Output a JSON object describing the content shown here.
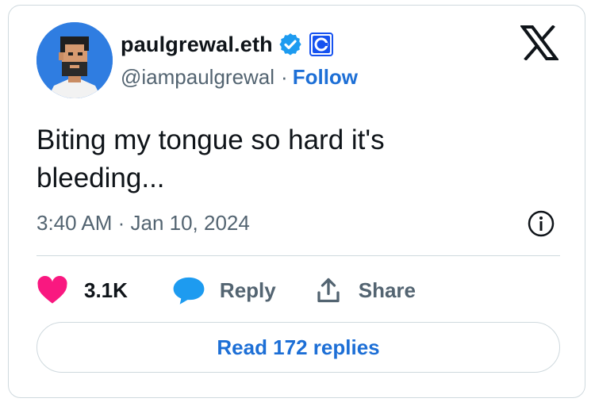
{
  "author": {
    "display_name": "paulgrewal.eth",
    "handle": "@iampaulgrewal",
    "separator": "·",
    "follow_label": "Follow",
    "verified_color": "#1d9bf0",
    "affiliate_color": "#1652f0"
  },
  "tweet": {
    "text": "Biting my tongue so hard it's bleeding...",
    "time": "3:40 AM · Jan 10, 2024"
  },
  "actions": {
    "likes": "3.1K",
    "reply_label": "Reply",
    "share_label": "Share",
    "like_color": "#f91880",
    "reply_color": "#1d9bf0"
  },
  "footer": {
    "replies_button": "Read 172 replies"
  },
  "icons": [
    "avatar",
    "verified-badge-icon",
    "coinbase-icon",
    "x-logo-icon",
    "info-icon",
    "heart-icon",
    "reply-bubble-icon",
    "share-icon"
  ]
}
